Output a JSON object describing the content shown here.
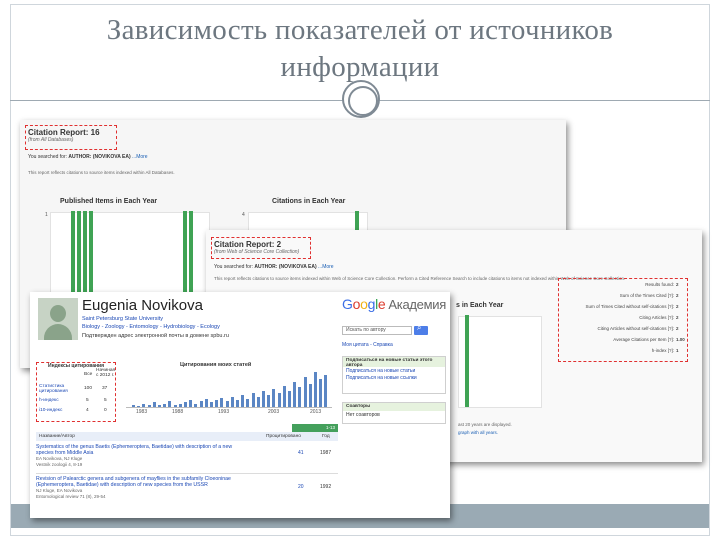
{
  "slide": {
    "title_line1": "Зависимость показателей от источников",
    "title_line2": "информации"
  },
  "wos_back": {
    "report_title": "Citation Report: 16",
    "report_source": "(from All Databases)",
    "searched_prefix": "You searched for:",
    "searched_query": "AUTHOR: (NOVIKOVA EA)",
    "more": "...More",
    "note": "This report reflects citations to source items indexed within All Databases.",
    "chart_left_title": "Published Items in Each Year",
    "chart_right_title": "Citations in Each Year",
    "left_tick": "1",
    "right_tick": "4"
  },
  "wos_front": {
    "report_title": "Citation Report: 2",
    "report_source": "(from Web of Science Core Collection)",
    "searched_prefix": "You searched for:",
    "searched_query": "AUTHOR: (NOVIKOVA EA)",
    "more": "...More",
    "note": "This report reflects citations to source items indexed within Web of Science Core Collection. Perform a Cited Reference Search to include citations to items not indexed within Web of Science Core Collection.",
    "chart_title": "s in Each Year",
    "footer_note_1": "ast 20 years are displayed.",
    "footer_note_2": "graph with all years.",
    "stats": [
      {
        "label": "Results found:",
        "value": "2"
      },
      {
        "label": "Sum of the Times Cited [?]:",
        "value": "2"
      },
      {
        "label": "Sum of Times Cited without self-citations [?]:",
        "value": "2"
      },
      {
        "label": "Citing Articles [?]:",
        "value": "2"
      },
      {
        "label": "Citing Articles without self-citations [?]:",
        "value": "2"
      },
      {
        "label": "Average Citations per Item [?]:",
        "value": "1.00"
      },
      {
        "label": "h-index [?]:",
        "value": "1"
      }
    ]
  },
  "scholar": {
    "name": "Eugenia Novikova",
    "affiliation": "Saint Petersburg State University",
    "interests": "Biology - Zoology - Entomology - Hydrobiology - Ecology",
    "email_note": "Подтвержден адрес электронной почты в домене spbu.ru",
    "logo_letters": [
      "G",
      "o",
      "o",
      "g",
      "l",
      "e"
    ],
    "logo_suffix": "Академия",
    "search_placeholder": "Искать по автору",
    "side_links": "Моя цитата - Справка",
    "follow_box": {
      "header": "Подписаться на новые статьи этого автора",
      "items": [
        "Подписаться на новые статьи",
        "Подписаться на новые ссылки"
      ]
    },
    "coauthors_box": {
      "header": "Соавторы",
      "items": [
        "Нет соавторов"
      ]
    },
    "cites_table": {
      "title": "Индексы цитирования",
      "col_all": "Все",
      "col_since": "Начиная с 2012 г.",
      "rows": [
        {
          "label": "Статистика цитирования",
          "all": "100",
          "since": "37"
        },
        {
          "label": "h-индекс",
          "all": "5",
          "since": "5"
        },
        {
          "label": "i10-индекс",
          "all": "4",
          "since": "0"
        }
      ]
    },
    "cites_chart_title": "Цитирования моих статей",
    "cites_chart_ticks": [
      "1983",
      "1988",
      "1993",
      "2003",
      "2013"
    ],
    "articles_header_title": "Название/Автор",
    "articles_header_cited": "Процитировано",
    "articles_header_year": "Год",
    "pagination": "1-13",
    "articles": [
      {
        "title": "Systematics of the genus Baetis (Ephemeroptera, Baetidae) with description of a new species from Middle Asia",
        "authors": "EA Novikova, NJ Kluge",
        "venue": "Vestnik zoologii 4, 8-19",
        "cited": "41",
        "year": "1987"
      },
      {
        "title": "Revision of Palearctic genera and subgenera of mayflies in the subfamily Cloeoninae (Ephemeroptera, Baetidae) with description of new species from the USSR",
        "authors": "NJ Kluge, EA Novikova",
        "venue": "Entomological review 71 (8), 29-54",
        "cited": "20",
        "year": "1992"
      }
    ]
  }
}
